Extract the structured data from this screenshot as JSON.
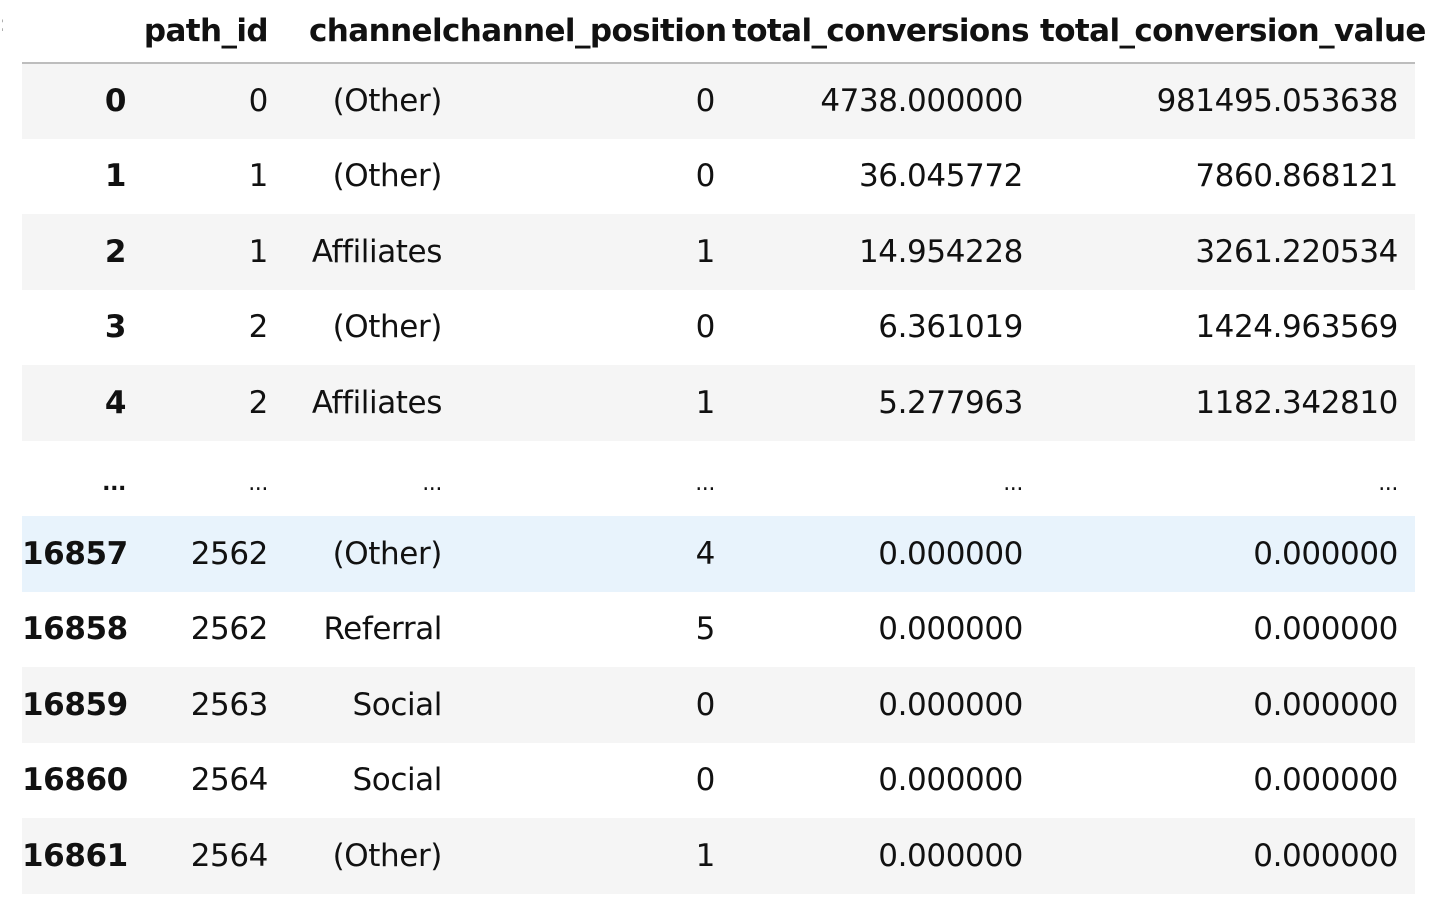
{
  "table": {
    "columns": [
      "",
      "path_id",
      "channel",
      "channel_position",
      "total_conversions",
      "total_conversion_value"
    ],
    "rows": [
      {
        "index": "0",
        "path_id": "0",
        "channel": "(Other)",
        "channel_position": "0",
        "total_conversions": "4738.000000",
        "total_conversion_value": "981495.053638"
      },
      {
        "index": "1",
        "path_id": "1",
        "channel": "(Other)",
        "channel_position": "0",
        "total_conversions": "36.045772",
        "total_conversion_value": "7860.868121"
      },
      {
        "index": "2",
        "path_id": "1",
        "channel": "Affiliates",
        "channel_position": "1",
        "total_conversions": "14.954228",
        "total_conversion_value": "3261.220534"
      },
      {
        "index": "3",
        "path_id": "2",
        "channel": "(Other)",
        "channel_position": "0",
        "total_conversions": "6.361019",
        "total_conversion_value": "1424.963569"
      },
      {
        "index": "4",
        "path_id": "2",
        "channel": "Affiliates",
        "channel_position": "1",
        "total_conversions": "5.277963",
        "total_conversion_value": "1182.342810"
      },
      {
        "index": "...",
        "path_id": "...",
        "channel": "...",
        "channel_position": "...",
        "total_conversions": "...",
        "total_conversion_value": "..."
      },
      {
        "index": "16857",
        "path_id": "2562",
        "channel": "(Other)",
        "channel_position": "4",
        "total_conversions": "0.000000",
        "total_conversion_value": "0.000000"
      },
      {
        "index": "16858",
        "path_id": "2562",
        "channel": "Referral",
        "channel_position": "5",
        "total_conversions": "0.000000",
        "total_conversion_value": "0.000000"
      },
      {
        "index": "16859",
        "path_id": "2563",
        "channel": "Social",
        "channel_position": "0",
        "total_conversions": "0.000000",
        "total_conversion_value": "0.000000"
      },
      {
        "index": "16860",
        "path_id": "2564",
        "channel": "Social",
        "channel_position": "0",
        "total_conversions": "0.000000",
        "total_conversion_value": "0.000000"
      },
      {
        "index": "16861",
        "path_id": "2564",
        "channel": "(Other)",
        "channel_position": "1",
        "total_conversions": "0.000000",
        "total_conversion_value": "0.000000"
      }
    ]
  }
}
